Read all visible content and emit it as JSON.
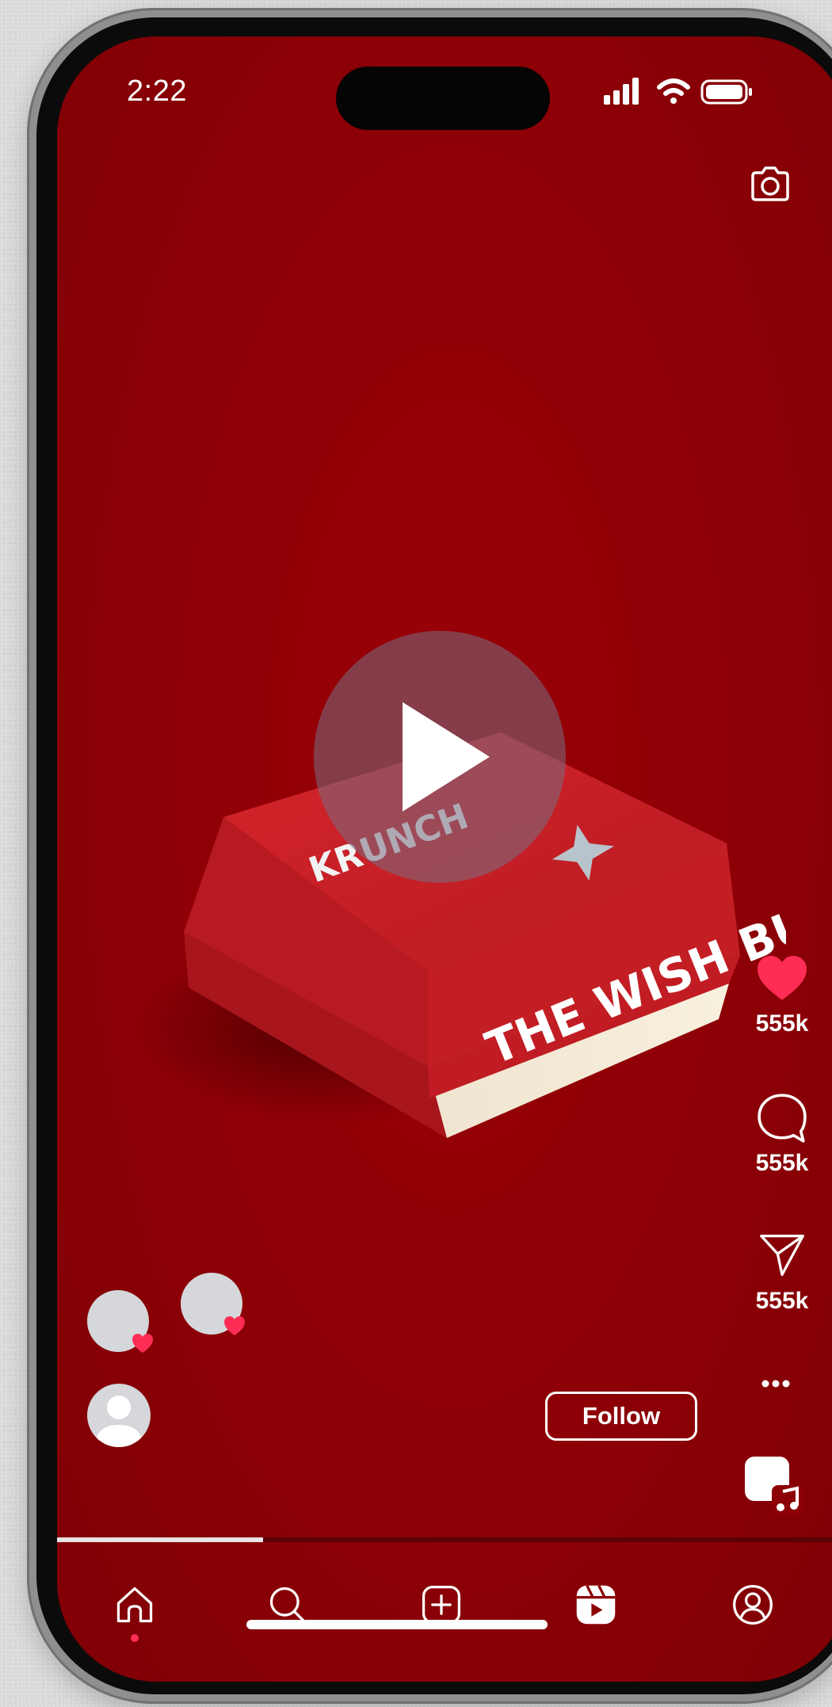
{
  "status_bar": {
    "time": "2:22"
  },
  "post": {
    "box_brand": "KRUNCH",
    "box_title": "THE WISH BURGER"
  },
  "actions": {
    "likes": "555k",
    "comments": "555k",
    "shares": "555k"
  },
  "follow_label": "Follow",
  "playback_progress": 0.26,
  "tabs": [
    "home",
    "search",
    "create",
    "reels",
    "profile"
  ],
  "active_tab": "reels",
  "colors": {
    "background": "#8c0006",
    "like_heart": "#ff2d55",
    "text": "#ffffff"
  },
  "icons": {
    "camera": "camera-icon",
    "like": "heart-icon",
    "comment": "comment-icon",
    "share": "send-icon",
    "more": "more-icon",
    "audio": "audio-icon"
  }
}
